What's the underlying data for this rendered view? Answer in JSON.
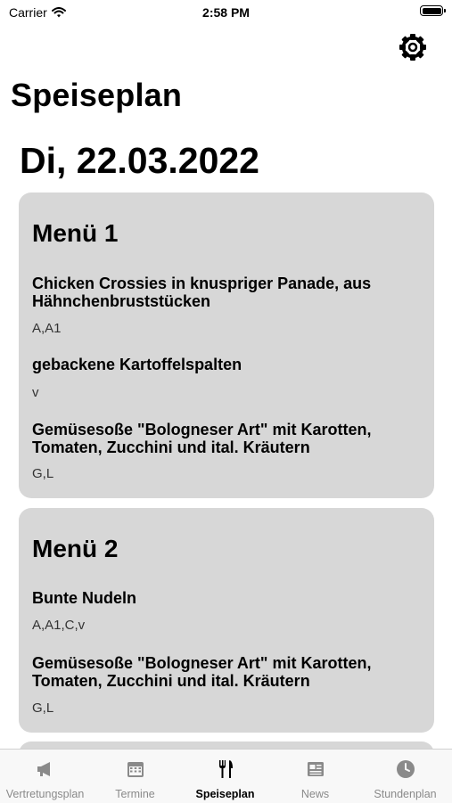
{
  "status_bar": {
    "carrier": "Carrier",
    "time": "2:58 PM"
  },
  "header": {
    "title": "Speiseplan",
    "settings_icon": "gear-icon"
  },
  "day": {
    "date": "Di, 22.03.2022"
  },
  "menus": [
    {
      "title": "Menü 1",
      "dishes": [
        {
          "name": "Chicken Crossies in knuspriger Panade, aus Hähnchenbruststücken",
          "allergens": "A,A1"
        },
        {
          "name": "gebackene Kartoffelspalten",
          "allergens": "v"
        },
        {
          "name": "Gemüsesoße \"Bologneser Art\" mit Karotten, Tomaten, Zucchini und ital. Kräutern",
          "allergens": "G,L"
        }
      ]
    },
    {
      "title": "Menü 2",
      "dishes": [
        {
          "name": "Bunte Nudeln",
          "allergens": "A,A1,C,v"
        },
        {
          "name": "Gemüsesoße \"Bologneser Art\" mit Karotten, Tomaten, Zucchini und ital. Kräutern",
          "allergens": "G,L"
        }
      ]
    }
  ],
  "tabs": [
    {
      "label": "Vertretungsplan",
      "icon": "megaphone-icon",
      "active": false
    },
    {
      "label": "Termine",
      "icon": "calendar-icon",
      "active": false
    },
    {
      "label": "Speiseplan",
      "icon": "fork-knife-icon",
      "active": true
    },
    {
      "label": "News",
      "icon": "newspaper-icon",
      "active": false
    },
    {
      "label": "Stundenplan",
      "icon": "clock-icon",
      "active": false
    }
  ]
}
